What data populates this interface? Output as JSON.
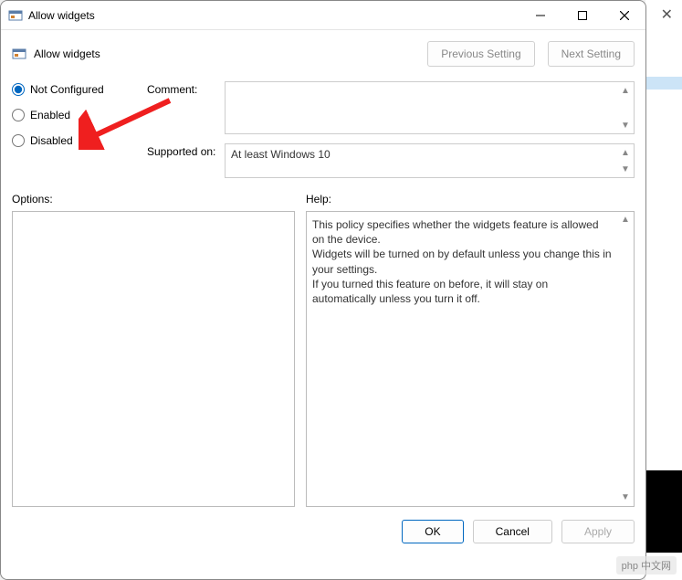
{
  "window": {
    "title": "Allow widgets"
  },
  "header": {
    "title": "Allow widgets",
    "prev_label": "Previous Setting",
    "next_label": "Next Setting"
  },
  "radios": {
    "not_configured": "Not Configured",
    "enabled": "Enabled",
    "disabled": "Disabled",
    "selected": "not_configured"
  },
  "fields": {
    "comment_label": "Comment:",
    "comment_value": "",
    "supported_label": "Supported on:",
    "supported_value": "At least Windows 10"
  },
  "panels": {
    "options_label": "Options:",
    "help_label": "Help:",
    "help_text": "This policy specifies whether the widgets feature is allowed on the device.\nWidgets will be turned on by default unless you change this in your settings.\nIf you turned this feature on before, it will stay on automatically unless you turn it off."
  },
  "buttons": {
    "ok": "OK",
    "cancel": "Cancel",
    "apply": "Apply"
  },
  "watermark": "php 中文网"
}
